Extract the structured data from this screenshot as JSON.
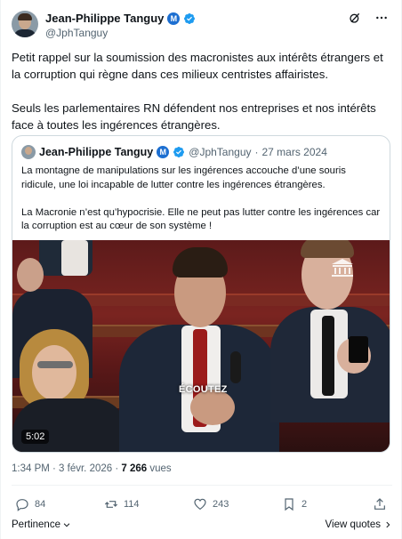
{
  "author": {
    "name": "Jean-Philippe Tanguy",
    "handle": "@JphTanguy",
    "party_badge": "M"
  },
  "tweet": {
    "paragraphs": [
      "Petit rappel sur la soumission des macronistes aux intérêts étrangers et la corruption qui règne dans ces milieux centristes affairistes.",
      "Seuls les parlementaires RN défendent nos entreprises et nos intérêts face à toutes les ingérences étrangères."
    ]
  },
  "quote": {
    "name": "Jean-Philippe Tanguy",
    "handle": "@JphTanguy",
    "separator": "·",
    "date": "27 mars 2024",
    "paragraphs": [
      "La montagne de manipulations sur les ingérences accouche d’une souris ridicule, une loi incapable de lutter contre les ingérences étrangères.",
      "La Macronie n’est qu’hypocrisie. Elle ne peut pas lutter contre les ingérences car la corruption est au cœur de son système !"
    ],
    "video": {
      "caption": "ÉCOUTEZ",
      "duration": "5:02"
    }
  },
  "meta": {
    "time_date": "1:34 PM · 3 févr. 2026 · ",
    "views_count": "7 266",
    "views_label": " vues"
  },
  "actions": {
    "replies": "84",
    "reposts": "114",
    "likes": "243",
    "bookmarks": "2"
  },
  "footer": {
    "pertinence": "Pertinence",
    "view_quotes": "View quotes"
  },
  "colors": {
    "verified": "#1d9bf0",
    "party_badge": "#1d6fd1",
    "secondary_text": "#536471"
  },
  "icons": [
    "verified-icon",
    "grok-icon",
    "more-icon",
    "reply-icon",
    "repost-icon",
    "like-icon",
    "bookmark-icon",
    "share-icon",
    "chevron-down-icon",
    "chevron-right-icon"
  ]
}
